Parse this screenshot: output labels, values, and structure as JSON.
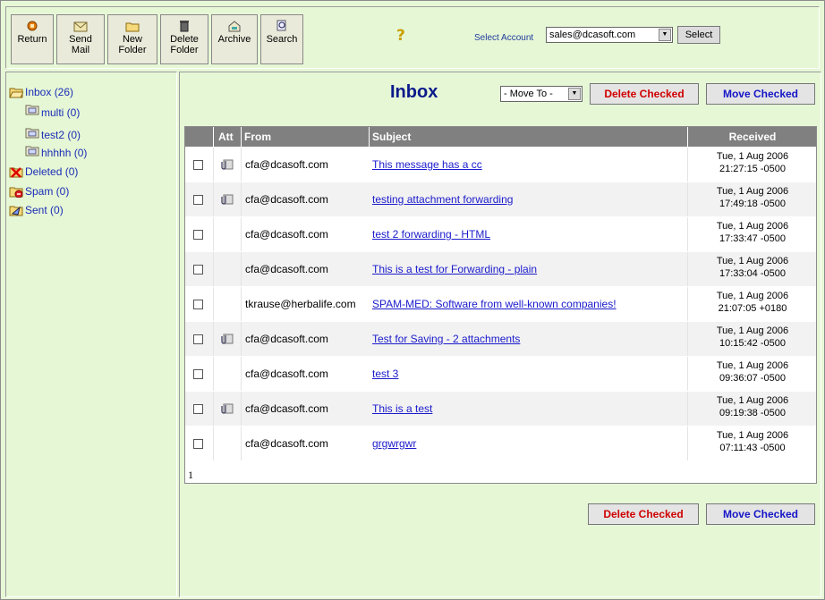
{
  "toolbar": {
    "buttons": [
      {
        "label": "Return",
        "icon": "return-icon"
      },
      {
        "label": "Send Mail",
        "icon": "send-mail-icon"
      },
      {
        "label": "New Folder",
        "icon": "new-folder-icon"
      },
      {
        "label": "Delete Folder",
        "icon": "delete-folder-icon"
      },
      {
        "label": "Archive",
        "icon": "archive-icon"
      },
      {
        "label": "Search",
        "icon": "search-icon"
      }
    ],
    "account_label": "Select Account",
    "account_value": "sales@dcasoft.com",
    "account_button": "Select"
  },
  "folders": [
    {
      "label": "Inbox (26)",
      "icon": "folder-open-icon"
    },
    {
      "label": "multi (0)",
      "icon": "folder-icon"
    },
    {
      "label": "test2 (0)",
      "icon": "folder-icon"
    },
    {
      "label": "hhhhh (0)",
      "icon": "folder-icon"
    },
    {
      "label": "Deleted (0)",
      "icon": "deleted-icon"
    },
    {
      "label": "Spam (0)",
      "icon": "spam-icon"
    },
    {
      "label": "Sent (0)",
      "icon": "sent-icon"
    }
  ],
  "main": {
    "title": "Inbox",
    "move_to": "- Move To -",
    "delete_checked": "Delete Checked",
    "move_checked": "Move Checked"
  },
  "table": {
    "headers": {
      "att": "Att",
      "from": "From",
      "subject": "Subject",
      "received": "Received"
    },
    "rows": [
      {
        "att": true,
        "from": "cfa@dcasoft.com",
        "subject": "This message has a cc",
        "date": "Tue, 1 Aug 2006",
        "time": "21:27:15 -0500"
      },
      {
        "att": true,
        "from": "cfa@dcasoft.com",
        "subject": "testing attachment forwarding",
        "date": "Tue, 1 Aug 2006",
        "time": "17:49:18 -0500"
      },
      {
        "att": false,
        "from": "cfa@dcasoft.com",
        "subject": "test 2 forwarding - HTML",
        "date": "Tue, 1 Aug 2006",
        "time": "17:33:47 -0500"
      },
      {
        "att": false,
        "from": "cfa@dcasoft.com",
        "subject": "This is a test for Forwarding - plain",
        "date": "Tue, 1 Aug 2006",
        "time": "17:33:04 -0500"
      },
      {
        "att": false,
        "from": "tkrause@herbalife.com",
        "subject": "SPAM-MED: Software from well-known companies!",
        "date": "Tue, 1 Aug 2006",
        "time": "21:07:05 +0180"
      },
      {
        "att": true,
        "from": "cfa@dcasoft.com",
        "subject": "Test for Saving - 2 attachments",
        "date": "Tue, 1 Aug 2006",
        "time": "10:15:42 -0500"
      },
      {
        "att": false,
        "from": "cfa@dcasoft.com",
        "subject": "test 3",
        "date": "Tue, 1 Aug 2006",
        "time": "09:36:07 -0500"
      },
      {
        "att": true,
        "from": "cfa@dcasoft.com",
        "subject": "This is a test",
        "date": "Tue, 1 Aug 2006",
        "time": "09:19:38 -0500"
      },
      {
        "att": false,
        "from": "cfa@dcasoft.com",
        "subject": "grgwrgwr",
        "date": "Tue, 1 Aug 2006",
        "time": "07:11:43 -0500"
      }
    ],
    "page": "1"
  }
}
